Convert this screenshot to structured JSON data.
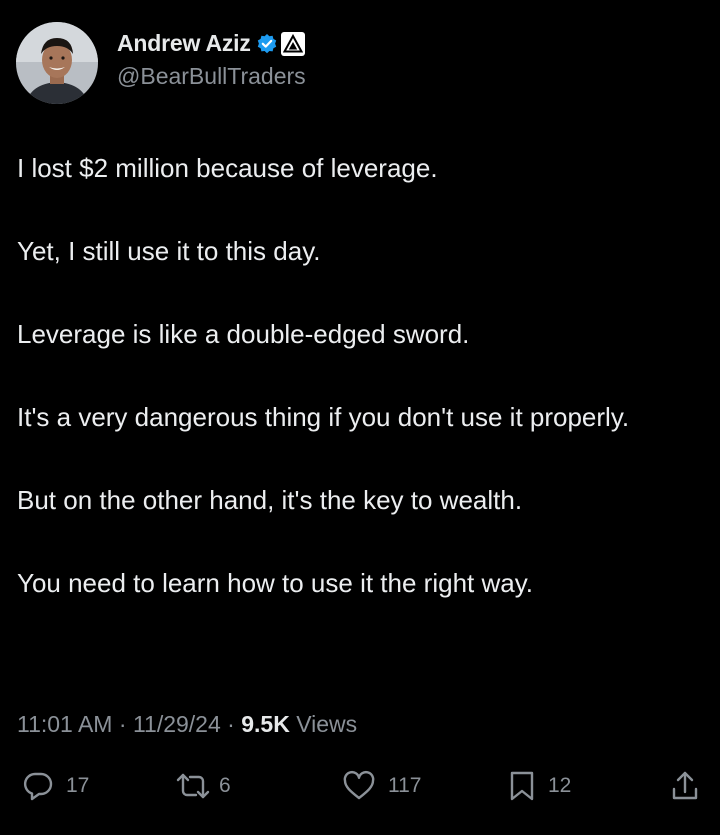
{
  "author": {
    "display_name": "Andrew Aziz",
    "handle": "@BearBullTraders",
    "verified": true,
    "verified_color": "#1d9bf0",
    "affiliate_badge_icon": "bear-bull-triangle-icon"
  },
  "tweet": {
    "paragraphs": [
      "I lost $2 million because of leverage.",
      "Yet, I still use it to this day.",
      "Leverage is like a double-edged sword.",
      "It's a very dangerous thing if you don't use it properly.",
      "But on the other hand, it's the key to wealth.",
      "You need to learn how to use it the right way."
    ]
  },
  "meta": {
    "time": "11:01 AM",
    "separator": "·",
    "date": "11/29/24",
    "views_count": "9.5K",
    "views_label": "Views"
  },
  "actions": {
    "replies": "17",
    "reposts": "6",
    "likes": "117",
    "bookmarks": "12"
  },
  "colors": {
    "background": "#000000",
    "text": "#e7e9ea",
    "muted": "#8b9198"
  }
}
